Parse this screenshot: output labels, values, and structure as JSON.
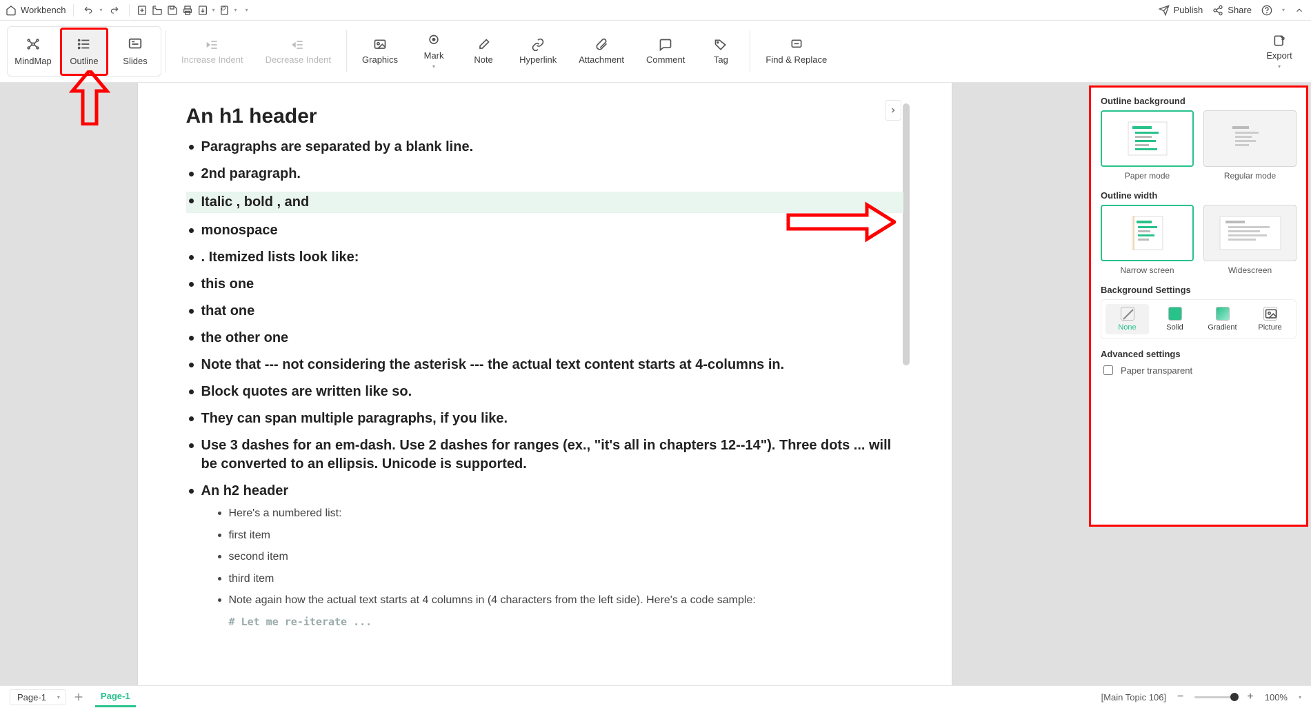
{
  "titlebar": {
    "workbench": "Workbench",
    "publish": "Publish",
    "share": "Share"
  },
  "ribbon": {
    "views": {
      "mindmap": "MindMap",
      "outline": "Outline",
      "slides": "Slides"
    },
    "tools": {
      "inc_indent": "Increase Indent",
      "dec_indent": "Decrease Indent",
      "graphics": "Graphics",
      "mark": "Mark",
      "note": "Note",
      "hyperlink": "Hyperlink",
      "attachment": "Attachment",
      "comment": "Comment",
      "tag": "Tag",
      "find_replace": "Find & Replace",
      "export": "Export"
    }
  },
  "document": {
    "title": "An h1 header",
    "items": [
      {
        "text": "Paragraphs are separated by a blank line."
      },
      {
        "text": "2nd paragraph."
      },
      {
        "text": "Italic , bold , and",
        "highlight": true
      },
      {
        "text": "monospace"
      },
      {
        "text": ". Itemized lists look like:"
      },
      {
        "text": "this one"
      },
      {
        "text": "that one"
      },
      {
        "text": "the other one"
      },
      {
        "text": "Note that --- not considering the asterisk --- the actual text content starts at 4-columns in."
      },
      {
        "text": "Block quotes are written like so."
      },
      {
        "text": "They can span multiple paragraphs, if you like."
      },
      {
        "text": "Use 3 dashes for an em-dash. Use 2 dashes for ranges (ex., \"it's all in chapters 12--14\"). Three dots ... will be converted to an ellipsis. Unicode is supported."
      },
      {
        "text": "An h2 header",
        "sub": [
          "Here's a numbered list:",
          "first item",
          "second item",
          "third item",
          "Note again how the actual text starts at 4 columns in (4 characters from the left side). Here's a code sample:"
        ],
        "code": "# Let me re-iterate ..."
      }
    ]
  },
  "panel": {
    "bg_title": "Outline background",
    "bg_paper": "Paper mode",
    "bg_regular": "Regular mode",
    "width_title": "Outline width",
    "width_narrow": "Narrow screen",
    "width_wide": "Widescreen",
    "bgset_title": "Background Settings",
    "bg_none": "None",
    "bg_solid": "Solid",
    "bg_gradient": "Gradient",
    "bg_picture": "Picture",
    "adv_title": "Advanced settings",
    "paper_transparent": "Paper transparent"
  },
  "status": {
    "page_selector": "Page-1",
    "tab": "Page-1",
    "topic": "[Main Topic 106]",
    "zoom": "100%"
  },
  "colors": {
    "accent": "#28c28b",
    "highlight_red": "#ff0000"
  }
}
